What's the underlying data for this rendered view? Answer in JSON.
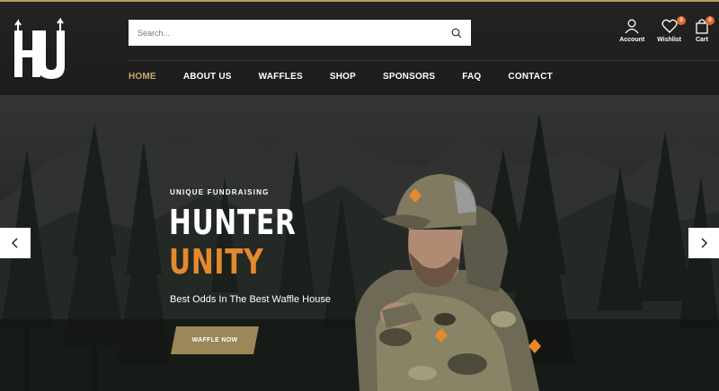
{
  "header": {
    "search": {
      "placeholder": "Search..."
    },
    "nav": [
      {
        "label": "HOME",
        "active": true
      },
      {
        "label": "ABOUT US"
      },
      {
        "label": "WAFFLES"
      },
      {
        "label": "SHOP"
      },
      {
        "label": "SPONSORS"
      },
      {
        "label": "FAQ"
      },
      {
        "label": "CONTACT"
      }
    ],
    "account": {
      "label": "Account",
      "icon": "user-icon"
    },
    "wishlist": {
      "label": "Wishlist",
      "count": "0",
      "icon": "heart-icon"
    },
    "cart": {
      "label": "Cart",
      "count": "0",
      "icon": "bag-icon"
    }
  },
  "hero": {
    "eyebrow": "UNIQUE FUNDRAISING",
    "title_line1": "HUNTER",
    "title_line2": "UNITY",
    "subtitle": "Best Odds In The Best Waffle House",
    "cta_label": "WAFFLE NOW"
  },
  "colors": {
    "accent_gold": "#c8a96a",
    "accent_orange": "#e58a2c",
    "button_olive": "#9b8758",
    "header_bg": "#1c1c1c"
  }
}
